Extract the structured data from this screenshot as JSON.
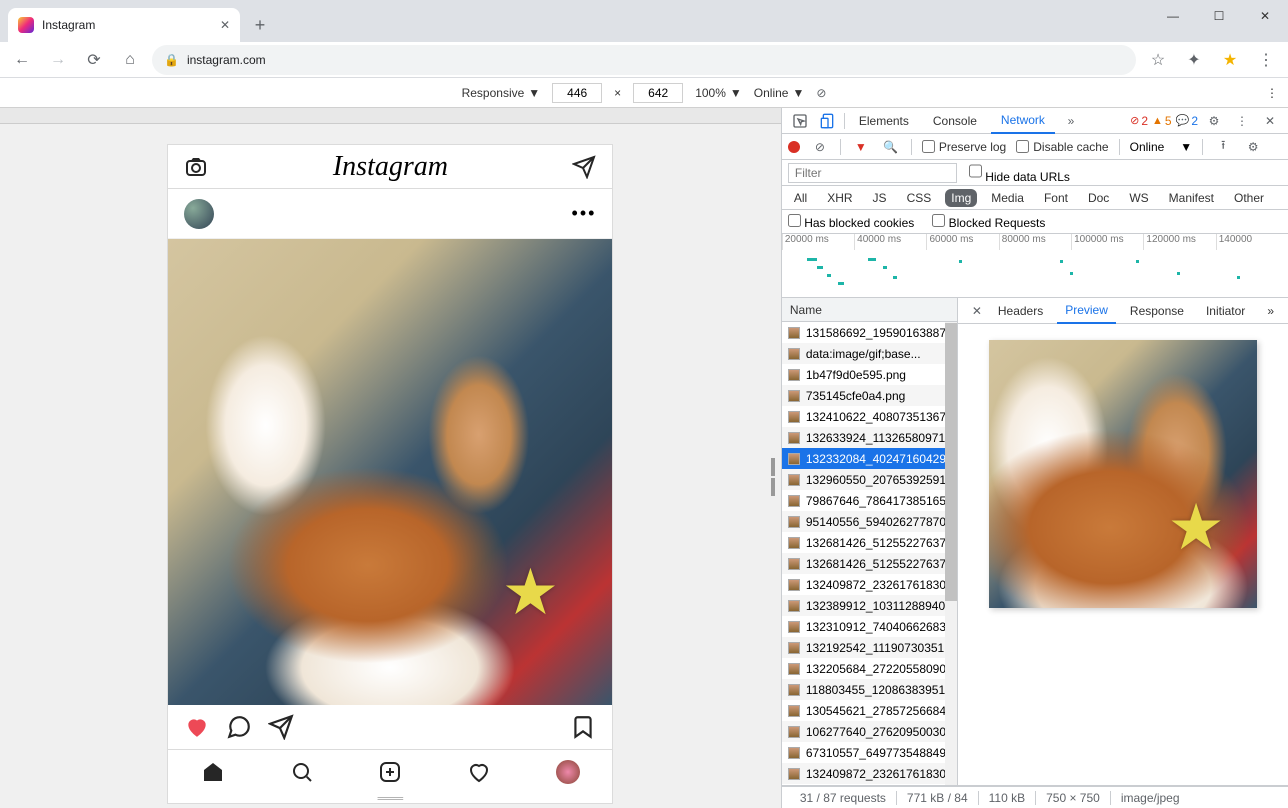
{
  "browser": {
    "tab_title": "Instagram",
    "url": "instagram.com"
  },
  "device_toolbar": {
    "mode": "Responsive",
    "width": "446",
    "height": "642",
    "zoom": "100%",
    "throttle": "Online"
  },
  "instagram": {
    "logo": "Instagram"
  },
  "devtools": {
    "tabs": [
      "Elements",
      "Console",
      "Network"
    ],
    "active_tab": "Network",
    "error_count": "2",
    "warn_count": "5",
    "info_count": "2",
    "preserve_log": "Preserve log",
    "disable_cache": "Disable cache",
    "throttle": "Online",
    "filter_placeholder": "Filter",
    "hide_data_urls": "Hide data URLs",
    "type_filters": [
      "All",
      "XHR",
      "JS",
      "CSS",
      "Img",
      "Media",
      "Font",
      "Doc",
      "WS",
      "Manifest",
      "Other"
    ],
    "type_active": "Img",
    "blocked_cookies": "Has blocked cookies",
    "blocked_requests": "Blocked Requests",
    "timeline_ticks": [
      "20000 ms",
      "40000 ms",
      "60000 ms",
      "80000 ms",
      "100000 ms",
      "120000 ms",
      "140000"
    ],
    "list_header": "Name",
    "requests": [
      "131586692_19590163887",
      "data:image/gif;base...",
      "1b47f9d0e595.png",
      "735145cfe0a4.png",
      "132410622_40807351367",
      "132633924_11326580971",
      "132332084_40247160429",
      "132960550_20765392591",
      "79867646_786417385165",
      "95140556_594026277870",
      "132681426_51255227637",
      "132681426_51255227637",
      "132409872_23261761830",
      "132389912_10311288940",
      "132310912_74040662683",
      "132192542_11190730351",
      "132205684_27220558090",
      "118803455_12086383951",
      "130545621_27857256684",
      "106277640_27620950030",
      "67310557_649773548849",
      "132409872_23261761830"
    ],
    "selected_index": 6,
    "detail_tabs": [
      "Headers",
      "Preview",
      "Response",
      "Initiator"
    ],
    "detail_active": "Preview",
    "status": {
      "requests": "31 / 87 requests",
      "transferred": "771 kB / 84",
      "resources": "110 kB",
      "dimensions": "750 × 750",
      "mime": "image/jpeg"
    }
  }
}
